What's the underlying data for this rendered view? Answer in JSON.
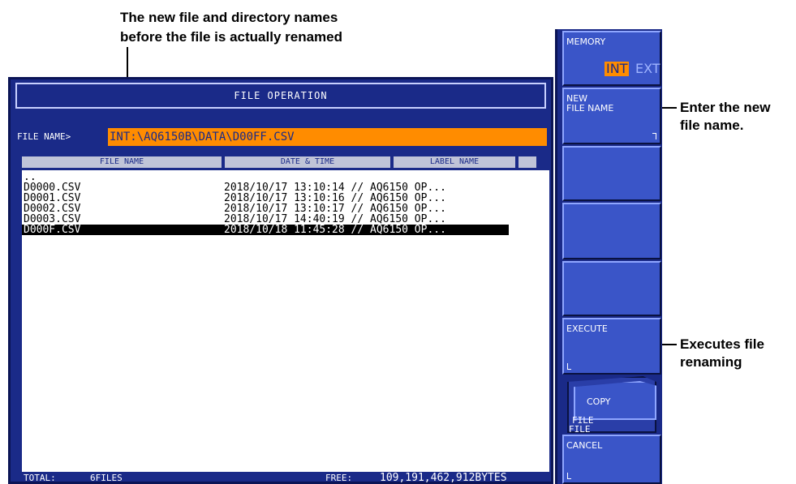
{
  "annotations": {
    "top_line1": "The new file and directory names",
    "top_line2": "before the file is actually renamed",
    "new_name_line1": "Enter the new",
    "new_name_line2": "file name.",
    "execute_line1": "Executes file",
    "execute_line2": "renaming"
  },
  "window": {
    "title": "FILE OPERATION",
    "file_name_label": "FILE NAME>",
    "file_name_value": "INT:\\AQ6150B\\DATA\\D00FF.CSV"
  },
  "columns": {
    "file_name": "FILE NAME",
    "date_time": "DATE & TIME",
    "label_name": "LABEL NAME"
  },
  "files": [
    {
      "name": "..",
      "datetime": ""
    },
    {
      "name": "D0000.CSV",
      "datetime": "2018/10/17 13:10:14 // AQ6150 OP..."
    },
    {
      "name": "D0001.CSV",
      "datetime": "2018/10/17 13:10:16 // AQ6150 OP..."
    },
    {
      "name": "D0002.CSV",
      "datetime": "2018/10/17 13:10:17 // AQ6150 OP..."
    },
    {
      "name": "D0003.CSV",
      "datetime": "2018/10/17 14:40:19 // AQ6150 OP..."
    },
    {
      "name": "D000F.CSV",
      "datetime": "2018/10/18 11:45:28 // AQ6150 OP..."
    }
  ],
  "status": {
    "total_label": "TOTAL:",
    "total_value": "6FILES",
    "free_label": "FREE:",
    "free_value": "109,191,462,912BYTES"
  },
  "softkeys": {
    "memory_label": "MEMORY",
    "memory_int": "INT",
    "memory_ext": "EXT",
    "new_file_name": "NEW\nFILE NAME",
    "execute": "EXECUTE",
    "copy": "COPY",
    "file_tag1": "FILE",
    "file_tag2": "FILE",
    "cancel": "CANCEL"
  },
  "colors": {
    "screen_bg": "#1a2a88",
    "softkey": "#3a55c8",
    "highlight": "#ff8c00"
  }
}
